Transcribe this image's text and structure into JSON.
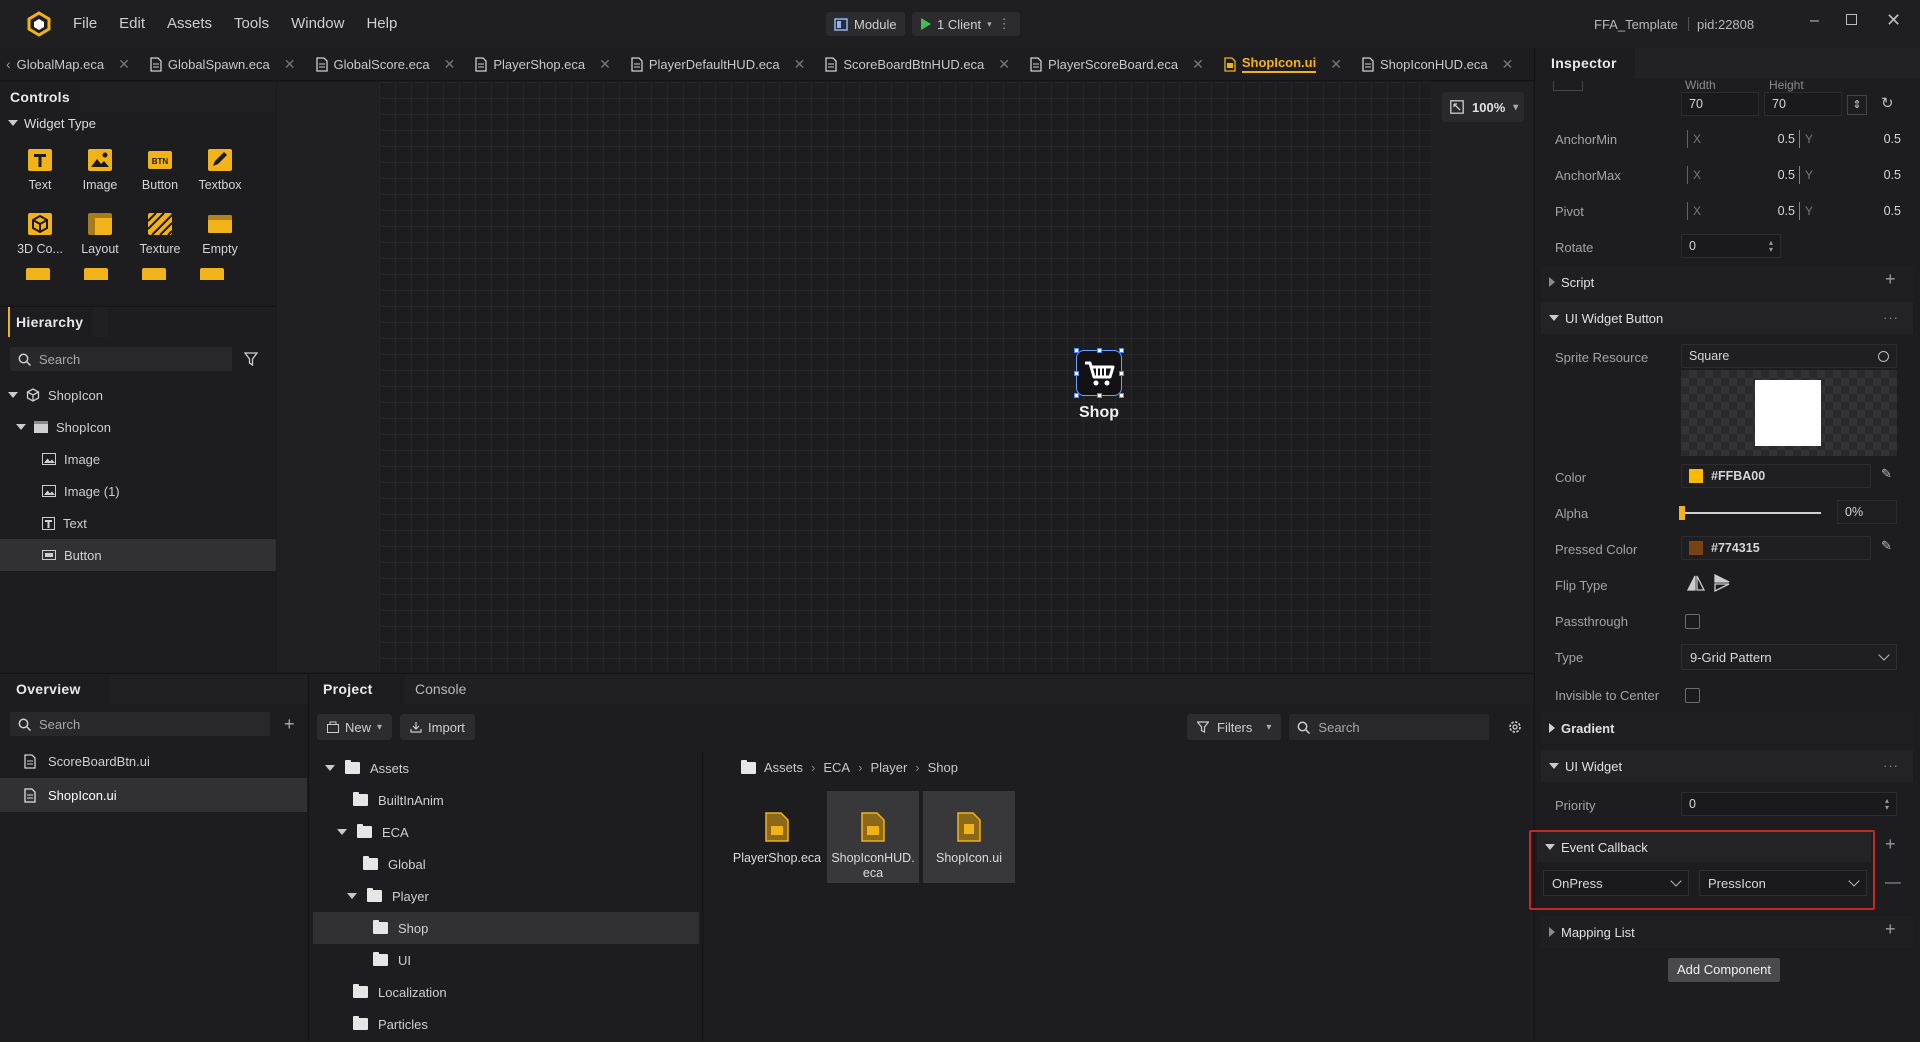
{
  "menu": {
    "file": "File",
    "edit": "Edit",
    "assets": "Assets",
    "tools": "Tools",
    "window": "Window",
    "help": "Help"
  },
  "toolbar": {
    "module": "Module",
    "client": "1 Client"
  },
  "titlebar": {
    "project": "FFA_Template",
    "pid": "pid:22808"
  },
  "tabs": [
    {
      "label": "GlobalMap.eca"
    },
    {
      "label": "GlobalSpawn.eca"
    },
    {
      "label": "GlobalScore.eca"
    },
    {
      "label": "PlayerShop.eca"
    },
    {
      "label": "PlayerDefaultHUD.eca"
    },
    {
      "label": "ScoreBoardBtnHUD.eca"
    },
    {
      "label": "PlayerScoreBoard.eca"
    },
    {
      "label": "ShopIcon.ui"
    },
    {
      "label": "ShopIconHUD.eca"
    }
  ],
  "controls": {
    "title": "Controls",
    "group": "Widget Type",
    "widgets": [
      {
        "label": "Text",
        "icon": "text-icon"
      },
      {
        "label": "Image",
        "icon": "image-icon"
      },
      {
        "label": "Button",
        "icon": "button-icon"
      },
      {
        "label": "Textbox",
        "icon": "textbox-icon"
      },
      {
        "label": "3D Co...",
        "icon": "cube-icon"
      },
      {
        "label": "Layout",
        "icon": "layout-icon"
      },
      {
        "label": "Texture",
        "icon": "texture-icon"
      },
      {
        "label": "Empty",
        "icon": "empty-icon"
      }
    ]
  },
  "hierarchy": {
    "title": "Hierarchy",
    "search_placeholder": "Search",
    "items": [
      {
        "label": "ShopIcon"
      },
      {
        "label": "ShopIcon"
      },
      {
        "label": "Image"
      },
      {
        "label": "Image (1)"
      },
      {
        "label": "Text"
      },
      {
        "label": "Button"
      }
    ]
  },
  "viewport": {
    "zoom": "100%",
    "widget_label": "Shop"
  },
  "overview": {
    "title": "Overview",
    "search_placeholder": "Search",
    "items": [
      {
        "label": "ScoreBoardBtn.ui"
      },
      {
        "label": "ShopIcon.ui"
      }
    ]
  },
  "project": {
    "tab_project": "Project",
    "tab_console": "Console",
    "new": "New",
    "import": "Import",
    "filters": "Filters",
    "search_placeholder": "Search",
    "tree": [
      {
        "label": "Assets"
      },
      {
        "label": "BuiltInAnim"
      },
      {
        "label": "ECA"
      },
      {
        "label": "Global"
      },
      {
        "label": "Player"
      },
      {
        "label": "Shop"
      },
      {
        "label": "UI"
      },
      {
        "label": "Localization"
      },
      {
        "label": "Particles"
      }
    ],
    "breadcrumb": [
      "Assets",
      "ECA",
      "Player",
      "Shop"
    ],
    "assets": [
      {
        "label": "PlayerShop.eca"
      },
      {
        "label": "ShopIconHUD.eca"
      },
      {
        "label": "ShopIcon.ui"
      }
    ]
  },
  "inspector": {
    "title": "Inspector",
    "width_label": "Width",
    "height_label": "Height",
    "width": "70",
    "height": "70",
    "anchor_min": {
      "label": "AnchorMin",
      "x": "0.5",
      "y": "0.5"
    },
    "anchor_max": {
      "label": "AnchorMax",
      "x": "0.5",
      "y": "0.5"
    },
    "pivot": {
      "label": "Pivot",
      "x": "0.5",
      "y": "0.5"
    },
    "rotate": {
      "label": "Rotate",
      "value": "0"
    },
    "x_label": "X",
    "y_label": "Y",
    "script": "Script",
    "ui_widget_button": "UI Widget Button",
    "sprite_resource": {
      "label": "Sprite Resource",
      "value": "Square"
    },
    "color": {
      "label": "Color",
      "value": "#FFBA00",
      "swatch": "#FFBA00"
    },
    "alpha": {
      "label": "Alpha",
      "value": "0%",
      "fraction": 0
    },
    "pressed_color": {
      "label": "Pressed Color",
      "value": "#774315",
      "swatch": "#774315"
    },
    "flip_type": "Flip Type",
    "passthrough": "Passthrough",
    "type": {
      "label": "Type",
      "value": "9-Grid Pattern"
    },
    "invisible_to_center": "Invisible to Center",
    "gradient": "Gradient",
    "ui_widget": "UI Widget",
    "priority": {
      "label": "Priority",
      "value": "0"
    },
    "event_callback": "Event Callback",
    "event": "OnPress",
    "callback": "PressIcon",
    "mapping_list": "Mapping List",
    "add_component": "Add Component"
  },
  "colors": {
    "accent": "#F2B21A",
    "highlight": "#C62828"
  }
}
